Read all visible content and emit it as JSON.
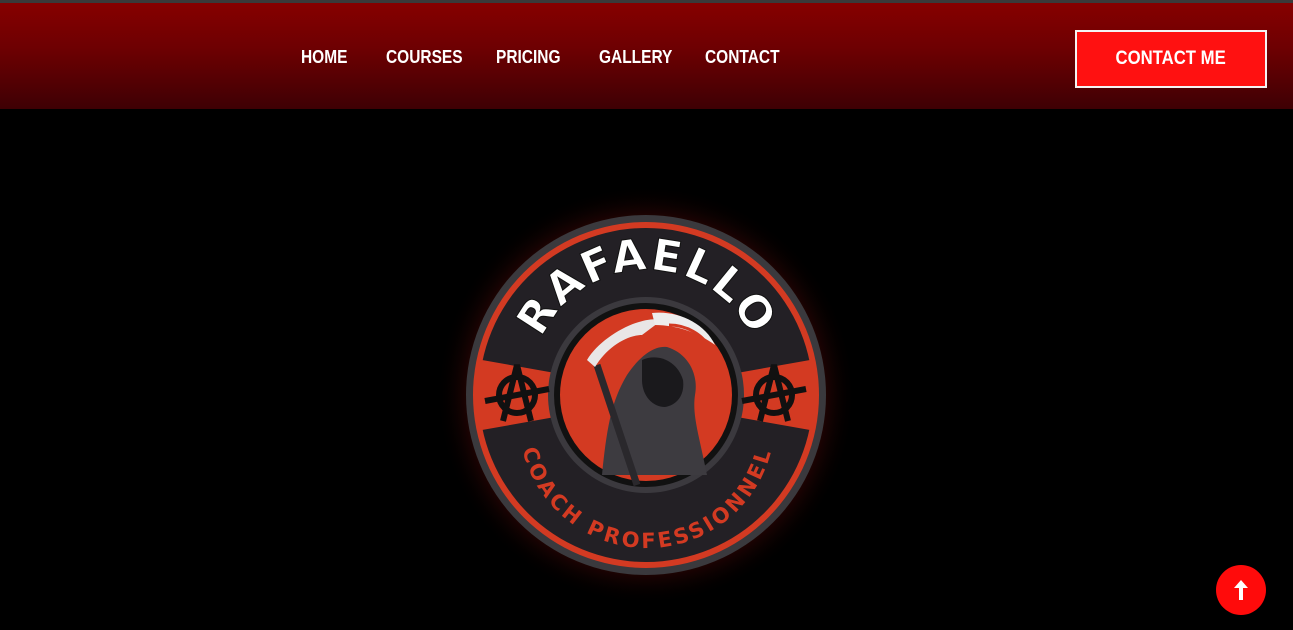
{
  "nav": {
    "items": [
      {
        "label": "HOME"
      },
      {
        "label": "COURSES"
      },
      {
        "label": "PRICING"
      },
      {
        "label": "GALLERY"
      },
      {
        "label": "CONTACT"
      }
    ],
    "cta_label": "CONTACT ME"
  },
  "logo": {
    "top_text": "RAFAELLO",
    "bottom_text": "COACH PROFESSIONNEL"
  },
  "colors": {
    "accent": "#ff1111",
    "header_top": "#860000",
    "header_bottom": "#3e0004",
    "badge_red": "#d33a22",
    "badge_dark": "#232025"
  },
  "scroll_top": {
    "icon": "arrow-up-icon"
  }
}
